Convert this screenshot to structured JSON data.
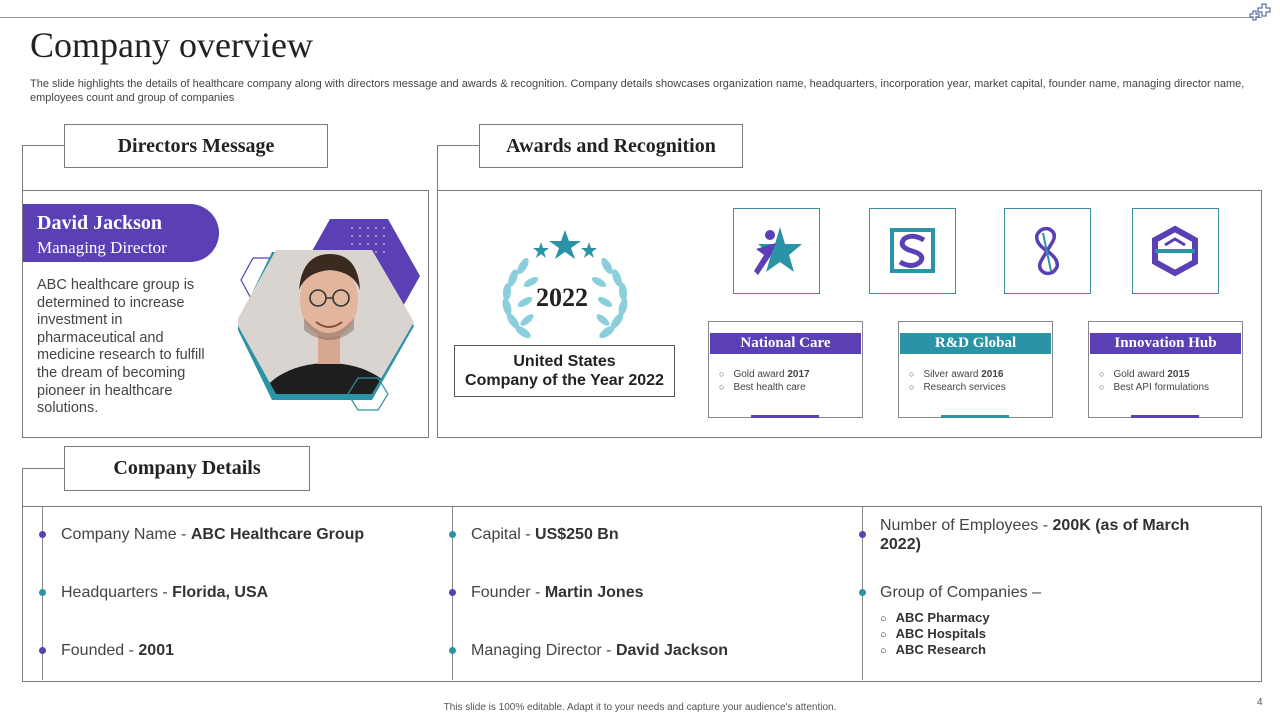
{
  "slide": {
    "title": "Company overview",
    "subtitle": "The slide highlights the details of healthcare company along with directors message and awards & recognition. Company details showcases organization name, headquarters, incorporation year, market capital, founder name, managing director name, employees count and group of companies",
    "footer": "This slide is 100% editable. Adapt it to your needs and capture your audience's attention.",
    "page_number": "4"
  },
  "directors": {
    "heading": "Directors Message",
    "name": "David Jackson",
    "role": "Managing Director",
    "message": "ABC healthcare group is determined to increase investment in pharmaceutical and medicine research to fulfill the dream of becoming pioneer in healthcare solutions."
  },
  "awards": {
    "heading": "Awards and Recognition",
    "year": "2022",
    "badge_line1": "United States",
    "badge_line2": "Company of the Year 2022",
    "cards": [
      {
        "title": "National Care",
        "color": "#5a3fb5",
        "item1_prefix": "Gold award ",
        "item1_year": "2017",
        "item2": "Best health care"
      },
      {
        "title": "R&D Global",
        "color": "#2a93a6",
        "item1_prefix": "Silver award ",
        "item1_year": "2016",
        "item2": "Research services"
      },
      {
        "title": "Innovation Hub",
        "color": "#5a3fb5",
        "item1_prefix": "Gold award ",
        "item1_year": "2015",
        "item2": "Best API formulations"
      }
    ]
  },
  "details": {
    "heading": "Company Details",
    "col1": [
      {
        "label": "Company Name - ",
        "value": "ABC Healthcare Group"
      },
      {
        "label": "Headquarters - ",
        "value": "Florida, USA"
      },
      {
        "label": "Founded - ",
        "value": "2001"
      }
    ],
    "col2": [
      {
        "label": "Capital - ",
        "value": "US$250 Bn"
      },
      {
        "label": "Founder - ",
        "value": "Martin Jones"
      },
      {
        "label": "Managing Director - ",
        "value": "David Jackson"
      }
    ],
    "employees_label": "Number of Employees - ",
    "employees_value": "200K (as of March 2022)",
    "group_label": "Group of Companies –",
    "group_items": [
      "ABC Pharmacy",
      "ABC Hospitals",
      "ABC Research"
    ]
  },
  "colors": {
    "purple": "#5a3fb5",
    "teal": "#2a93a6"
  }
}
